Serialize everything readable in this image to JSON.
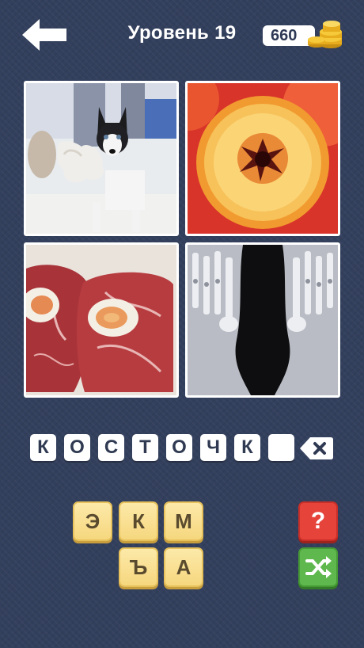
{
  "header": {
    "level_label": "Уровень 19",
    "coins": "660"
  },
  "photos": [
    {
      "icon": "husky-puppy-with-bone-toy"
    },
    {
      "icon": "peach-half-with-pit"
    },
    {
      "icon": "beef-shank-with-marrow-bone"
    },
    {
      "icon": "foot-bones-xray"
    }
  ],
  "answer": {
    "letters": [
      "К",
      "О",
      "С",
      "Т",
      "О",
      "Ч",
      "К",
      ""
    ]
  },
  "letter_tiles": [
    "Э",
    "К",
    "М",
    "Ъ",
    "А"
  ],
  "buttons": {
    "hint_label": "?"
  },
  "colors": {
    "background": "#33405d",
    "tile_yellow": "#f6d77e",
    "hint_red": "#e6433b",
    "shuffle_green": "#5fb84d"
  }
}
